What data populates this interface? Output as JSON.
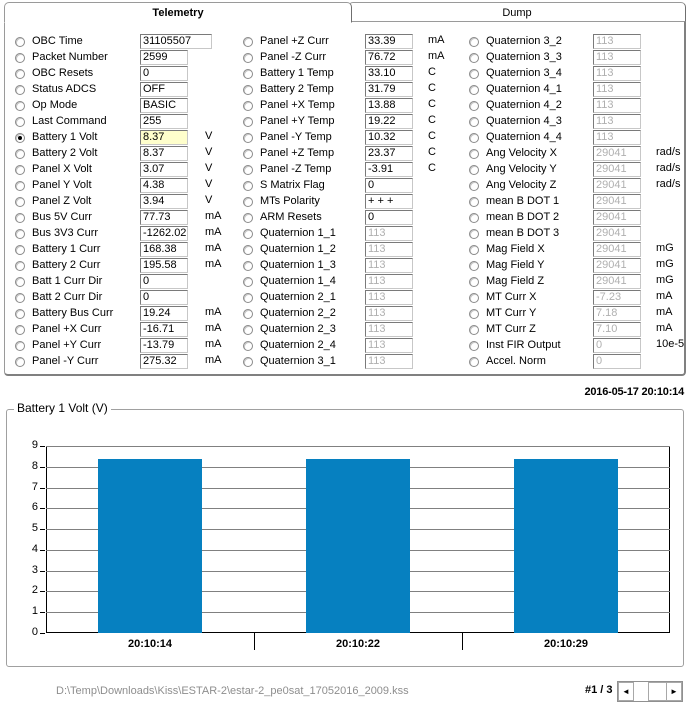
{
  "tabs": [
    {
      "label": "Telemetry",
      "active": true
    },
    {
      "label": "Dump",
      "active": false
    }
  ],
  "telemetry": {
    "columns": [
      {
        "id": "col-1",
        "rows": [
          {
            "label": "OBC Time",
            "value": "31105507",
            "unit": "",
            "selected": false,
            "dim": false,
            "wide": true
          },
          {
            "label": "Packet Number",
            "value": "2599",
            "unit": "",
            "selected": false,
            "dim": false
          },
          {
            "label": "OBC Resets",
            "value": "0",
            "unit": "",
            "selected": false,
            "dim": false
          },
          {
            "label": "Status ADCS",
            "value": "OFF",
            "unit": "",
            "selected": false,
            "dim": false
          },
          {
            "label": "Op Mode",
            "value": "BASIC",
            "unit": "",
            "selected": false,
            "dim": false
          },
          {
            "label": "Last Command",
            "value": "255",
            "unit": "",
            "selected": false,
            "dim": false
          },
          {
            "label": "Battery 1 Volt",
            "value": "8.37",
            "unit": "V",
            "selected": true,
            "dim": false,
            "highlight": true
          },
          {
            "label": "Battery 2 Volt",
            "value": "8.37",
            "unit": "V",
            "selected": false,
            "dim": false
          },
          {
            "label": "Panel X Volt",
            "value": "3.07",
            "unit": "V",
            "selected": false,
            "dim": false
          },
          {
            "label": "Panel Y Volt",
            "value": "4.38",
            "unit": "V",
            "selected": false,
            "dim": false
          },
          {
            "label": "Panel Z Volt",
            "value": "3.94",
            "unit": "V",
            "selected": false,
            "dim": false
          },
          {
            "label": "Bus 5V Curr",
            "value": "77.73",
            "unit": "mA",
            "selected": false,
            "dim": false
          },
          {
            "label": "Bus 3V3 Curr",
            "value": "-1262.02",
            "unit": "mA",
            "selected": false,
            "dim": false
          },
          {
            "label": "Battery 1 Curr",
            "value": "168.38",
            "unit": "mA",
            "selected": false,
            "dim": false
          },
          {
            "label": "Battery 2 Curr",
            "value": "195.58",
            "unit": "mA",
            "selected": false,
            "dim": false
          },
          {
            "label": "Batt 1 Curr Dir",
            "value": "0",
            "unit": "",
            "selected": false,
            "dim": false
          },
          {
            "label": "Batt 2 Curr Dir",
            "value": "0",
            "unit": "",
            "selected": false,
            "dim": false
          },
          {
            "label": "Battery Bus Curr",
            "value": "19.24",
            "unit": "mA",
            "selected": false,
            "dim": false
          },
          {
            "label": "Panel +X Curr",
            "value": "-16.71",
            "unit": "mA",
            "selected": false,
            "dim": false
          },
          {
            "label": "Panel +Y Curr",
            "value": "-13.79",
            "unit": "mA",
            "selected": false,
            "dim": false
          },
          {
            "label": "Panel -Y Curr",
            "value": "275.32",
            "unit": "mA",
            "selected": false,
            "dim": false
          }
        ]
      },
      {
        "id": "col-2",
        "rows": [
          {
            "label": "Panel +Z Curr",
            "value": "33.39",
            "unit": "mA",
            "selected": false,
            "dim": false
          },
          {
            "label": "Panel -Z Curr",
            "value": "76.72",
            "unit": "mA",
            "selected": false,
            "dim": false
          },
          {
            "label": "Battery 1 Temp",
            "value": "33.10",
            "unit": "C",
            "selected": false,
            "dim": false
          },
          {
            "label": "Battery 2 Temp",
            "value": "31.79",
            "unit": "C",
            "selected": false,
            "dim": false
          },
          {
            "label": "Panel +X Temp",
            "value": "13.88",
            "unit": "C",
            "selected": false,
            "dim": false
          },
          {
            "label": "Panel +Y Temp",
            "value": "19.22",
            "unit": "C",
            "selected": false,
            "dim": false
          },
          {
            "label": "Panel -Y Temp",
            "value": "10.32",
            "unit": "C",
            "selected": false,
            "dim": false
          },
          {
            "label": "Panel +Z Temp",
            "value": "23.37",
            "unit": "C",
            "selected": false,
            "dim": false
          },
          {
            "label": "Panel -Z Temp",
            "value": "-3.91",
            "unit": "C",
            "selected": false,
            "dim": false
          },
          {
            "label": "S Matrix Flag",
            "value": "0",
            "unit": "",
            "selected": false,
            "dim": false
          },
          {
            "label": "MTs Polarity",
            "value": "+ + +",
            "unit": "",
            "selected": false,
            "dim": false
          },
          {
            "label": "ARM Resets",
            "value": "0",
            "unit": "",
            "selected": false,
            "dim": false
          },
          {
            "label": "Quaternion 1_1",
            "value": "113",
            "unit": "",
            "selected": false,
            "dim": true
          },
          {
            "label": "Quaternion 1_2",
            "value": "113",
            "unit": "",
            "selected": false,
            "dim": true
          },
          {
            "label": "Quaternion 1_3",
            "value": "113",
            "unit": "",
            "selected": false,
            "dim": true
          },
          {
            "label": "Quaternion 1_4",
            "value": "113",
            "unit": "",
            "selected": false,
            "dim": true
          },
          {
            "label": "Quaternion 2_1",
            "value": "113",
            "unit": "",
            "selected": false,
            "dim": true
          },
          {
            "label": "Quaternion 2_2",
            "value": "113",
            "unit": "",
            "selected": false,
            "dim": true
          },
          {
            "label": "Quaternion 2_3",
            "value": "113",
            "unit": "",
            "selected": false,
            "dim": true
          },
          {
            "label": "Quaternion 2_4",
            "value": "113",
            "unit": "",
            "selected": false,
            "dim": true
          },
          {
            "label": "Quaternion 3_1",
            "value": "113",
            "unit": "",
            "selected": false,
            "dim": true
          }
        ]
      },
      {
        "id": "col-3",
        "rows": [
          {
            "label": "Quaternion 3_2",
            "value": "113",
            "unit": "",
            "selected": false,
            "dim": true
          },
          {
            "label": "Quaternion 3_3",
            "value": "113",
            "unit": "",
            "selected": false,
            "dim": true
          },
          {
            "label": "Quaternion 3_4",
            "value": "113",
            "unit": "",
            "selected": false,
            "dim": true
          },
          {
            "label": "Quaternion 4_1",
            "value": "113",
            "unit": "",
            "selected": false,
            "dim": true
          },
          {
            "label": "Quaternion 4_2",
            "value": "113",
            "unit": "",
            "selected": false,
            "dim": true
          },
          {
            "label": "Quaternion 4_3",
            "value": "113",
            "unit": "",
            "selected": false,
            "dim": true
          },
          {
            "label": "Quaternion 4_4",
            "value": "113",
            "unit": "",
            "selected": false,
            "dim": true
          },
          {
            "label": "Ang Velocity X",
            "value": "29041",
            "unit": "rad/s",
            "selected": false,
            "dim": true
          },
          {
            "label": "Ang Velocity Y",
            "value": "29041",
            "unit": "rad/s",
            "selected": false,
            "dim": true
          },
          {
            "label": "Ang Velocity Z",
            "value": "29041",
            "unit": "rad/s",
            "selected": false,
            "dim": true
          },
          {
            "label": "mean B DOT 1",
            "value": "29041",
            "unit": "",
            "selected": false,
            "dim": true
          },
          {
            "label": "mean B DOT 2",
            "value": "29041",
            "unit": "",
            "selected": false,
            "dim": true
          },
          {
            "label": "mean B DOT 3",
            "value": "29041",
            "unit": "",
            "selected": false,
            "dim": true
          },
          {
            "label": "Mag Field X",
            "value": "29041",
            "unit": "mG",
            "selected": false,
            "dim": true
          },
          {
            "label": "Mag Field Y",
            "value": "29041",
            "unit": "mG",
            "selected": false,
            "dim": true
          },
          {
            "label": "Mag Field Z",
            "value": "29041",
            "unit": "mG",
            "selected": false,
            "dim": true
          },
          {
            "label": "MT Curr X",
            "value": "-7.23",
            "unit": "mA",
            "selected": false,
            "dim": true
          },
          {
            "label": "MT Curr Y",
            "value": "7.18",
            "unit": "mA",
            "selected": false,
            "dim": true
          },
          {
            "label": "MT Curr Z",
            "value": "7.10",
            "unit": "mA",
            "selected": false,
            "dim": true
          },
          {
            "label": "Inst FIR Output",
            "value": "0",
            "unit": "10e-5",
            "selected": false,
            "dim": true
          },
          {
            "label": "Accel. Norm",
            "value": "0",
            "unit": "",
            "selected": false,
            "dim": true
          }
        ]
      }
    ]
  },
  "timestamp": "2016-05-17 20:10:14",
  "chart_data": {
    "type": "bar",
    "title": "Battery 1 Volt (V)",
    "xlabel": "",
    "ylabel": "",
    "categories": [
      "20:10:14",
      "20:10:22",
      "20:10:29"
    ],
    "values": [
      8.37,
      8.37,
      8.37
    ],
    "ylim": [
      0,
      9
    ],
    "yticks": [
      0,
      1,
      2,
      3,
      4,
      5,
      6,
      7,
      8,
      9
    ],
    "grid": true,
    "legend": "none",
    "bar_color": "#0680c0"
  },
  "footer": {
    "file_path": "D:\\Temp\\Downloads\\Kiss\\ESTAR-2\\estar-2_pe0sat_17052016_2009.kss",
    "page_counter": "#1 / 3",
    "scroll_left_glyph": "◄",
    "scroll_right_glyph": "►"
  }
}
